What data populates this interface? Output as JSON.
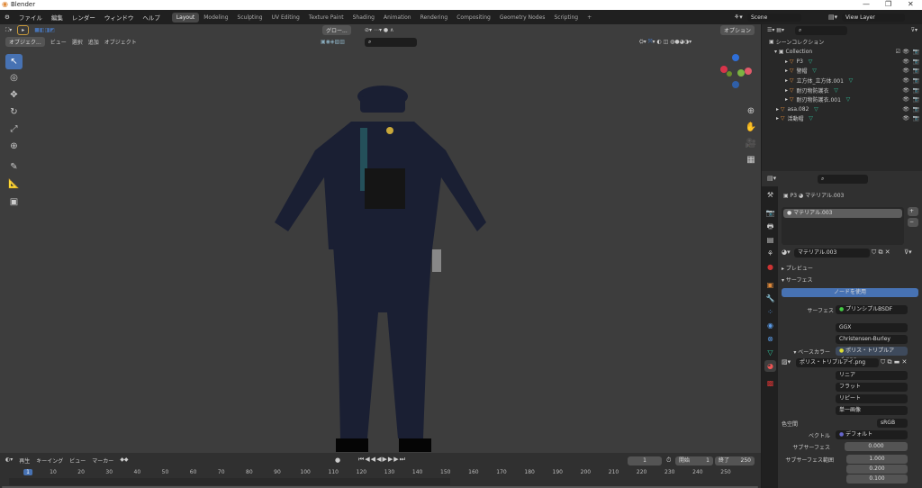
{
  "window": {
    "title": "Blender",
    "min": "—",
    "max": "❐",
    "close": "✕"
  },
  "menu": [
    "ファイル",
    "編集",
    "レンダー",
    "ウィンドウ",
    "ヘルプ"
  ],
  "workspaces": [
    "Layout",
    "Modeling",
    "Sculpting",
    "UV Editing",
    "Texture Paint",
    "Shading",
    "Animation",
    "Rendering",
    "Compositing",
    "Geometry Nodes",
    "Scripting",
    "+"
  ],
  "scene": {
    "label": "Scene",
    "view_layer": "View Layer"
  },
  "viewport": {
    "mode": "オブジェク...",
    "menus": [
      "ビュー",
      "選択",
      "追加",
      "オブジェクト"
    ],
    "orientation": "グロー...",
    "options": "オプション"
  },
  "outliner": {
    "root": "シーンコレクション",
    "collection": "Collection",
    "items": [
      {
        "name": "P3",
        "depth": 1
      },
      {
        "name": "警帽",
        "depth": 1
      },
      {
        "name": "立方体_立方体.001",
        "depth": 1
      },
      {
        "name": "耐刃物防護衣",
        "depth": 1
      },
      {
        "name": "耐刃物防護衣.001",
        "depth": 1
      },
      {
        "name": "asa.082",
        "depth": 0
      },
      {
        "name": "活動帽",
        "depth": 0
      }
    ]
  },
  "properties": {
    "object": "P3",
    "material": "マテリアル.003",
    "slot": "マテリアル.003",
    "material_field": "マテリアル.003",
    "preview": "プレビュー",
    "surface_panel": "サーフェス",
    "use_nodes": "ノードを使用",
    "surface_label": "サーフェス",
    "surface_value": "プリンシプルBSDF",
    "distribution": "GGX",
    "subsurface_method": "Christensen-Burley",
    "base_color_label": "ベースカラー",
    "base_color_value": "ポリス・トリプルアイ.png",
    "image": "ポリス・トリプルアイ.png",
    "interp": "リニア",
    "projection": "フラット",
    "extension": "リピート",
    "source": "単一画像",
    "colorspace_label": "色空間",
    "colorspace": "sRGB",
    "vector_label": "ベクトル",
    "vector": "デフォルト",
    "subsurface_label": "サブサーフェス",
    "subsurface": "0.000",
    "ss_radius_label": "サブサーフェス範囲",
    "ss_radius": [
      "1.000",
      "0.200",
      "0.100"
    ]
  },
  "timeline": {
    "menus": [
      "再生",
      "キーイング",
      "ビュー",
      "マーカー"
    ],
    "current": "1",
    "start_label": "開始",
    "start": "1",
    "end_label": "終了",
    "end": "250",
    "ticks": [
      "1",
      "10",
      "20",
      "30",
      "40",
      "50",
      "60",
      "70",
      "80",
      "90",
      "100",
      "110",
      "120",
      "130",
      "140",
      "150",
      "160",
      "170",
      "180",
      "190",
      "200",
      "210",
      "220",
      "230",
      "240",
      "250"
    ]
  },
  "colors": {
    "accent": "#4772b3",
    "viewport": "#3d3d3d",
    "uniform": "#1a1f33"
  }
}
